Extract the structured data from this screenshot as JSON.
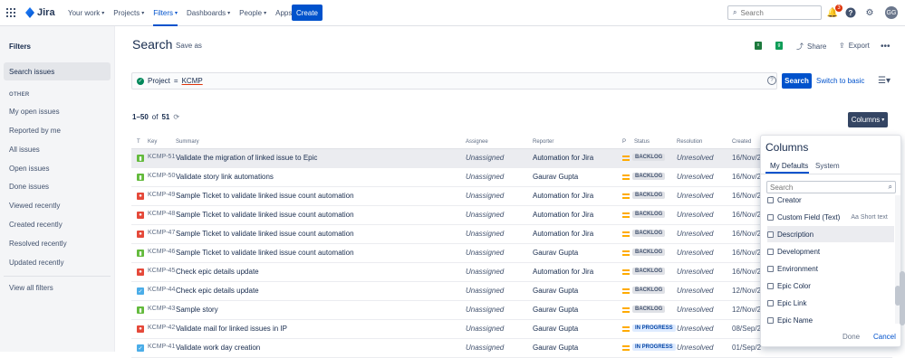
{
  "app": {
    "logo_text": "Jira"
  },
  "nav": {
    "items": [
      {
        "label": "Your work"
      },
      {
        "label": "Projects"
      },
      {
        "label": "Filters"
      },
      {
        "label": "Dashboards"
      },
      {
        "label": "People"
      },
      {
        "label": "Apps"
      }
    ],
    "create_label": "Create",
    "search_placeholder": "Search",
    "notification_count": "3",
    "avatar_initials": "GG"
  },
  "sidebar": {
    "title": "Filters",
    "search_issues": "Search issues",
    "section_other": "OTHER",
    "items": [
      {
        "label": "My open issues"
      },
      {
        "label": "Reported by me"
      },
      {
        "label": "All issues"
      },
      {
        "label": "Open issues"
      },
      {
        "label": "Done issues"
      },
      {
        "label": "Viewed recently"
      },
      {
        "label": "Created recently"
      },
      {
        "label": "Resolved recently"
      },
      {
        "label": "Updated recently"
      }
    ],
    "view_all": "View all filters"
  },
  "main": {
    "title": "Search",
    "save_as": "Save as",
    "share": "Share",
    "export": "Export",
    "query_field": "Project",
    "query_op": "=",
    "query_value": "KCMP",
    "search_button": "Search",
    "switch_basic": "Switch to basic",
    "count_range": "1–50",
    "count_of": "of",
    "count_total": "51",
    "columns_button": "Columns"
  },
  "table": {
    "headers": {
      "t": "T",
      "key": "Key",
      "summary": "Summary",
      "assignee": "Assignee",
      "reporter": "Reporter",
      "p": "P",
      "status": "Status",
      "resolution": "Resolution",
      "created": "Created"
    },
    "rows": [
      {
        "type": "story",
        "key": "KCMP-51",
        "summary": "Validate the migration of linked issue to Epic",
        "assignee": "Unassigned",
        "reporter": "Automation for Jira",
        "status": "BACKLOG",
        "resolution": "Unresolved",
        "created": "16/Nov/2"
      },
      {
        "type": "story",
        "key": "KCMP-50",
        "summary": "Validate story link automations",
        "assignee": "Unassigned",
        "reporter": "Gaurav Gupta",
        "status": "BACKLOG",
        "resolution": "Unresolved",
        "created": "16/Nov/2"
      },
      {
        "type": "bug",
        "key": "KCMP-49",
        "summary": "Sample Ticket to validate linked issue count automation",
        "assignee": "Unassigned",
        "reporter": "Automation for Jira",
        "status": "BACKLOG",
        "resolution": "Unresolved",
        "created": "16/Nov/2"
      },
      {
        "type": "bug",
        "key": "KCMP-48",
        "summary": "Sample Ticket to validate linked issue count automation",
        "assignee": "Unassigned",
        "reporter": "Automation for Jira",
        "status": "BACKLOG",
        "resolution": "Unresolved",
        "created": "16/Nov/2"
      },
      {
        "type": "bug",
        "key": "KCMP-47",
        "summary": "Sample Ticket to validate linked issue count automation",
        "assignee": "Unassigned",
        "reporter": "Automation for Jira",
        "status": "BACKLOG",
        "resolution": "Unresolved",
        "created": "16/Nov/2"
      },
      {
        "type": "story",
        "key": "KCMP-46",
        "summary": "Sample Ticket to validate linked issue count automation",
        "assignee": "Unassigned",
        "reporter": "Gaurav Gupta",
        "status": "BACKLOG",
        "resolution": "Unresolved",
        "created": "16/Nov/2"
      },
      {
        "type": "bug",
        "key": "KCMP-45",
        "summary": "Check epic details update",
        "assignee": "Unassigned",
        "reporter": "Automation for Jira",
        "status": "BACKLOG",
        "resolution": "Unresolved",
        "created": "16/Nov/2"
      },
      {
        "type": "task",
        "key": "KCMP-44",
        "summary": "Check epic details update",
        "assignee": "Unassigned",
        "reporter": "Gaurav Gupta",
        "status": "BACKLOG",
        "resolution": "Unresolved",
        "created": "12/Nov/2"
      },
      {
        "type": "story",
        "key": "KCMP-43",
        "summary": "Sample story",
        "assignee": "Unassigned",
        "reporter": "Gaurav Gupta",
        "status": "BACKLOG",
        "resolution": "Unresolved",
        "created": "12/Nov/2"
      },
      {
        "type": "bug",
        "key": "KCMP-42",
        "summary": "Validate mail for linked issues in IP",
        "assignee": "Unassigned",
        "reporter": "Gaurav Gupta",
        "status": "IN PROGRESS",
        "resolution": "Unresolved",
        "created": "08/Sep/2"
      },
      {
        "type": "task",
        "key": "KCMP-41",
        "summary": "Validate work day creation",
        "assignee": "Unassigned",
        "reporter": "Gaurav Gupta",
        "status": "IN PROGRESS",
        "resolution": "Unresolved",
        "created": "01/Sep/2"
      }
    ]
  },
  "columns_popup": {
    "title": "Columns",
    "tab_my_defaults": "My Defaults",
    "tab_system": "System",
    "search_placeholder": "Search",
    "options": [
      {
        "label": "Creator",
        "extra": ""
      },
      {
        "label": "Custom Field (Text)",
        "extra": "Short text"
      },
      {
        "label": "Description",
        "extra": ""
      },
      {
        "label": "Development",
        "extra": ""
      },
      {
        "label": "Environment",
        "extra": ""
      },
      {
        "label": "Epic Color",
        "extra": ""
      },
      {
        "label": "Epic Link",
        "extra": ""
      },
      {
        "label": "Epic Name",
        "extra": ""
      }
    ],
    "done": "Done",
    "cancel": "Cancel"
  },
  "colors": {
    "primary": "#0052cc",
    "backlog": "#dfe1e6",
    "in_progress": "#deebff",
    "story": "#63ba3c",
    "bug": "#e5493a",
    "task": "#4bade8"
  }
}
